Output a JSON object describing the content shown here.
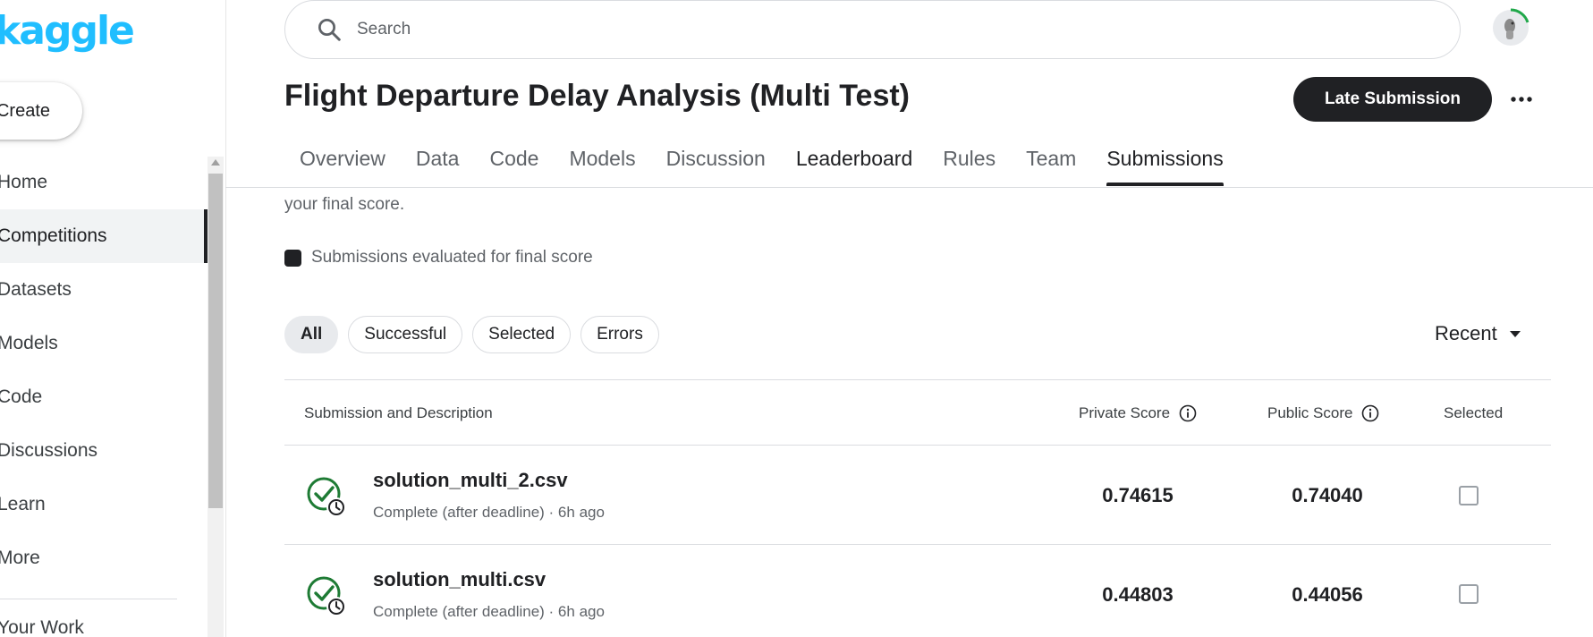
{
  "sidebar": {
    "logo": "kaggle",
    "create_label": "Create",
    "items": [
      {
        "label": "Home"
      },
      {
        "label": "Competitions"
      },
      {
        "label": "Datasets"
      },
      {
        "label": "Models"
      },
      {
        "label": "Code"
      },
      {
        "label": "Discussions"
      },
      {
        "label": "Learn"
      },
      {
        "label": "More"
      }
    ],
    "active_item": "Competitions",
    "your_work": "Your Work"
  },
  "header": {
    "search_placeholder": "Search"
  },
  "competition": {
    "title": "Flight Departure Delay Analysis (Multi Test)",
    "late_submission_label": "Late Submission",
    "more_icon": "more-horizontal-icon"
  },
  "tabs": [
    {
      "label": "Overview"
    },
    {
      "label": "Data"
    },
    {
      "label": "Code"
    },
    {
      "label": "Models"
    },
    {
      "label": "Discussion"
    },
    {
      "label": "Leaderboard"
    },
    {
      "label": "Rules"
    },
    {
      "label": "Team"
    },
    {
      "label": "Submissions"
    }
  ],
  "active_tab": "Submissions",
  "content": {
    "final_score_text": "your final score.",
    "legend_text": "Submissions evaluated for final score",
    "filters": [
      {
        "label": "All"
      },
      {
        "label": "Successful"
      },
      {
        "label": "Selected"
      },
      {
        "label": "Errors"
      }
    ],
    "active_filter": "All",
    "sort_label": "Recent"
  },
  "table": {
    "headers": {
      "submission": "Submission and Description",
      "private": "Private Score",
      "public": "Public Score",
      "selected": "Selected"
    },
    "rows": [
      {
        "file": "solution_multi_2.csv",
        "status": "Complete (after deadline) · 6h ago",
        "private_score": "0.74615",
        "public_score": "0.74040",
        "selected": false
      },
      {
        "file": "solution_multi.csv",
        "status": "Complete (after deadline) · 6h ago",
        "private_score": "0.44803",
        "public_score": "0.44056",
        "selected": false
      }
    ]
  },
  "colors": {
    "accent_logo": "#20beff",
    "success_green": "#1e7b34",
    "primary_dark": "#202124"
  }
}
